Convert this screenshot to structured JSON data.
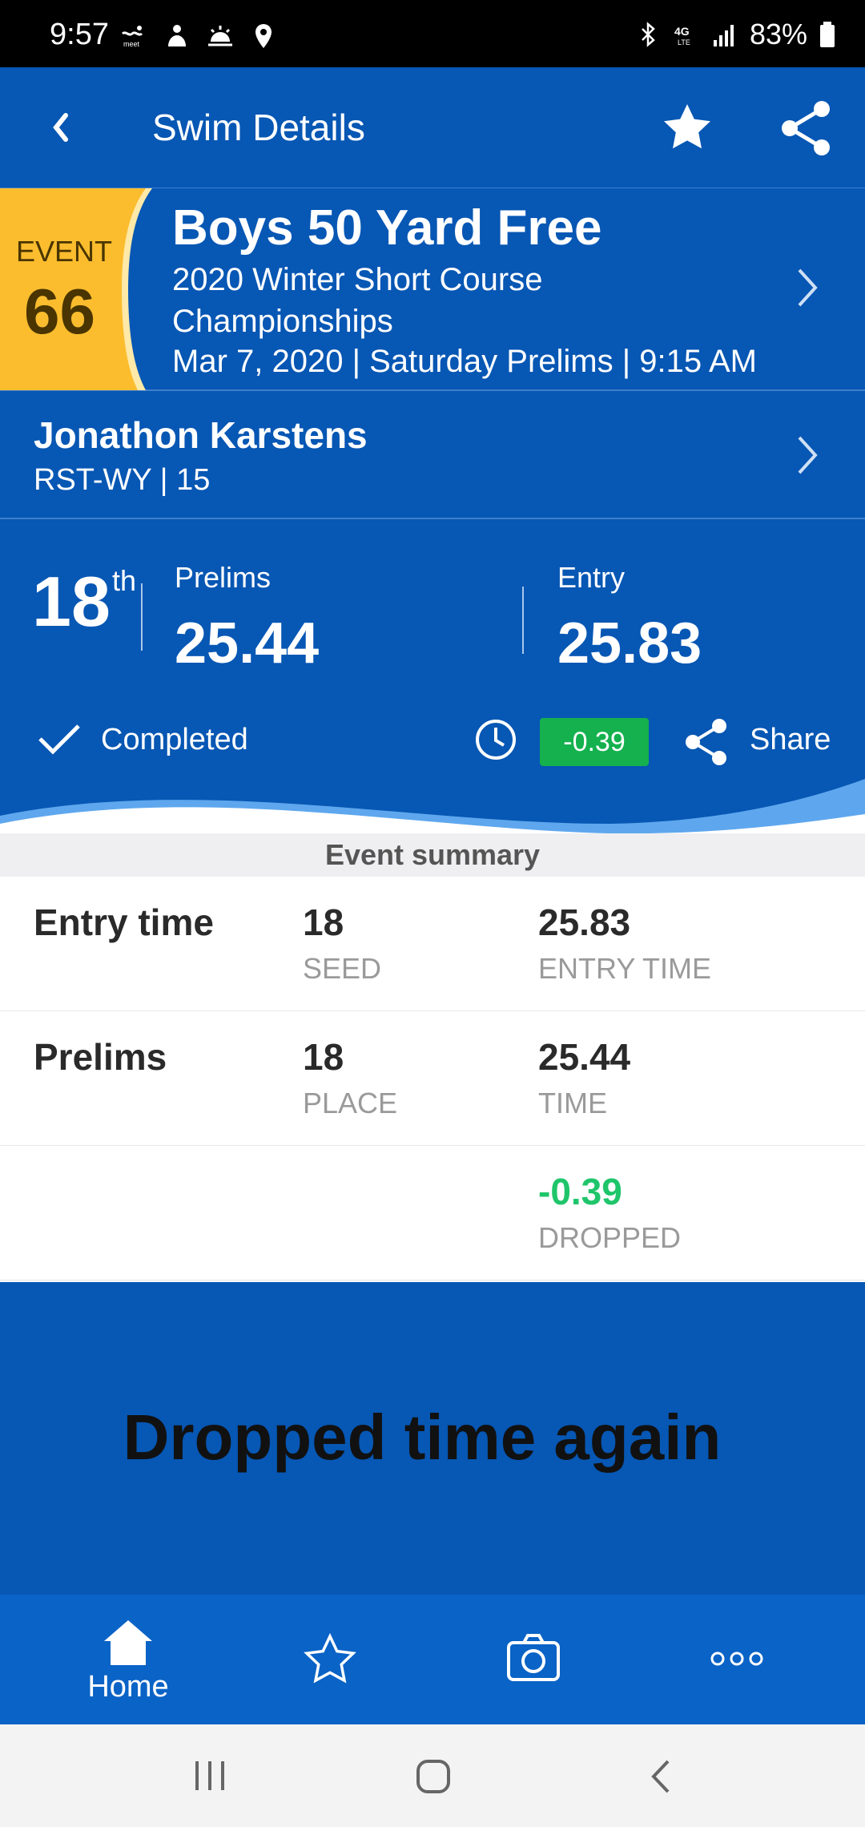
{
  "status_bar": {
    "time": "9:57",
    "battery": "83%"
  },
  "header": {
    "title": "Swim Details",
    "back_icon": "chevron-left-icon",
    "favorite_icon": "star-icon",
    "share_icon": "share-icon"
  },
  "event": {
    "badge_label": "EVENT",
    "badge_number": "66",
    "title": "Boys 50 Yard Free",
    "meet_name": "2020 Winter Short Course Championships",
    "date_line": "Mar 7, 2020 | Saturday Prelims | 9:15 AM"
  },
  "swimmer": {
    "name": "Jonathon Karstens",
    "team_age": "RST-WY | 15"
  },
  "result": {
    "place": "18",
    "place_suffix": "th",
    "prelims_label": "Prelims",
    "prelims_time": "25.44",
    "entry_label": "Entry",
    "entry_time": "25.83",
    "status": "Completed",
    "delta": "-0.39",
    "share_label": "Share"
  },
  "summary": {
    "header": "Event summary",
    "rows": [
      {
        "label": "Entry time",
        "col1_value": "18",
        "col1_sub": "SEED",
        "col2_value": "25.83",
        "col2_sub": "ENTRY TIME"
      },
      {
        "label": "Prelims",
        "col1_value": "18",
        "col1_sub": "PLACE",
        "col2_value": "25.44",
        "col2_sub": "TIME"
      },
      {
        "label": "",
        "col1_value": "",
        "col1_sub": "",
        "col2_value": "-0.39",
        "col2_sub": "DROPPED"
      }
    ]
  },
  "banner": {
    "text": "Dropped time again"
  },
  "bottom_nav": {
    "home_label": "Home",
    "items": [
      "home-icon",
      "star-icon",
      "camera-icon",
      "more-icon"
    ]
  },
  "colors": {
    "primary_blue": "#0757b4",
    "badge_yellow": "#fbbd2e",
    "success_green": "#14b14e",
    "drop_green": "#1fc56a"
  }
}
